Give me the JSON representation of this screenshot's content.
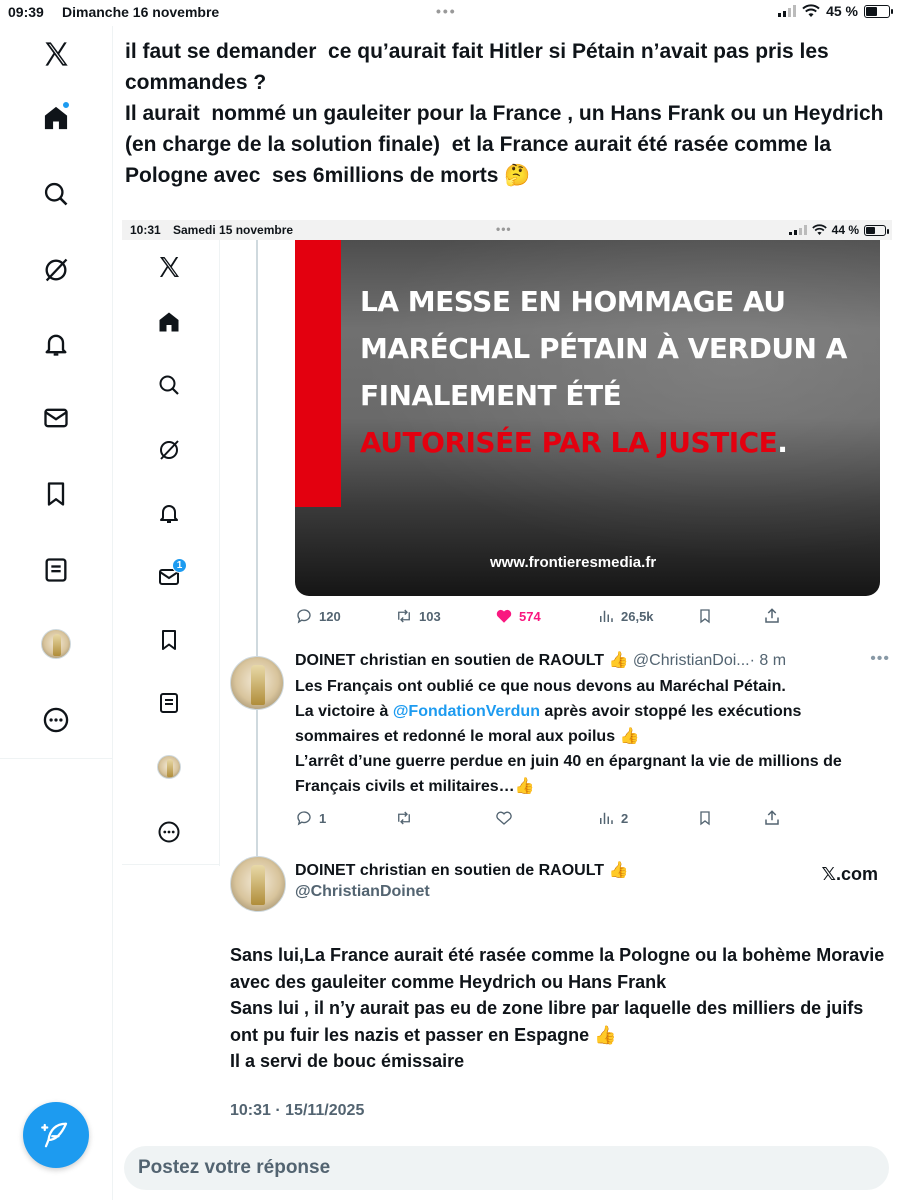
{
  "status_bar": {
    "time": "09:39",
    "date": "Dimanche 16 novembre",
    "dots": "•••",
    "battery": "45 %",
    "battery_level": 0.45
  },
  "sidebar": {
    "items": [
      {
        "icon": "x-logo-icon"
      },
      {
        "icon": "home-icon",
        "badge": true
      },
      {
        "icon": "search-icon"
      },
      {
        "icon": "grok-icon"
      },
      {
        "icon": "notifications-icon"
      },
      {
        "icon": "messages-icon"
      },
      {
        "icon": "bookmarks-icon"
      },
      {
        "icon": "lists-icon"
      },
      {
        "icon": "profile-avatar"
      },
      {
        "icon": "more-icon"
      }
    ],
    "compose_icon": "compose-feather-icon"
  },
  "tweet": {
    "text": "il faut se demander  ce qu’aurait fait Hitler si Pétain n’avait pas pris les commandes ?\nIl aurait  nommé un gauleiter pour la France , un Hans Frank ou un Heydrich (en charge de la solution finale)  et la France aurait été rasée comme la Pologne avec  ses 6millions de morts 🤔"
  },
  "screenshot": {
    "status_bar": {
      "time": "10:31",
      "date": "Samedi 15 novembre",
      "dots": "•••",
      "battery": "44 %",
      "battery_level": 0.44
    },
    "sidebar": {
      "messages_badge": "1"
    },
    "media": {
      "headline_white": "LA MESSE EN HOMMAGE AU MARÉCHAL PÉTAIN À VERDUN A FINALEMENT ÉTÉ",
      "headline_red": "AUTORISÉE PAR LA JUSTICE",
      "headline_period": ".",
      "site": "www.frontieresmedia.fr",
      "accent_red": "#e3000f"
    },
    "post_actions": {
      "replies": "120",
      "reposts": "103",
      "likes": "574",
      "views": "26,5k",
      "like_color": "#f91880"
    },
    "reply": {
      "name": "DOINET christian en soutien de RAOULT 👍",
      "handle": "@ChristianDoi...",
      "time": "· 8 m",
      "more": "•••",
      "text_1": "Les Français ont oublié ce que nous devons au Maréchal Pétain.\nLa victoire à ",
      "mention": "@FondationVerdun",
      "text_2": " après avoir stoppé les exécutions sommaires et redonné le moral aux poilus 👍\nL’arrêt d’une guerre perdue en juin 40 en épargnant la vie de millions de Français civils et militaires…👍",
      "actions": {
        "replies": "1",
        "views": "2"
      }
    }
  },
  "embed": {
    "name": "DOINET christian en soutien de RAOULT 👍",
    "handle": "@ChristianDoinet",
    "source": "𝕏.com",
    "body": "Sans lui,La France aurait été rasée comme la Pologne ou la bohème Moravie avec des gauleiter comme Heydrich ou Hans Frank\nSans lui , il n’y aurait pas eu de zone libre par laquelle des milliers de juifs ont pu fuir les nazis et passer en Espagne 👍\nIl a servi de bouc émissaire",
    "timestamp": "10:31 · 15/11/2025"
  },
  "reply_box": {
    "placeholder": "Postez votre réponse"
  },
  "colors": {
    "accent": "#1d9bf0",
    "text": "#0f1419",
    "secondary": "#536471"
  }
}
